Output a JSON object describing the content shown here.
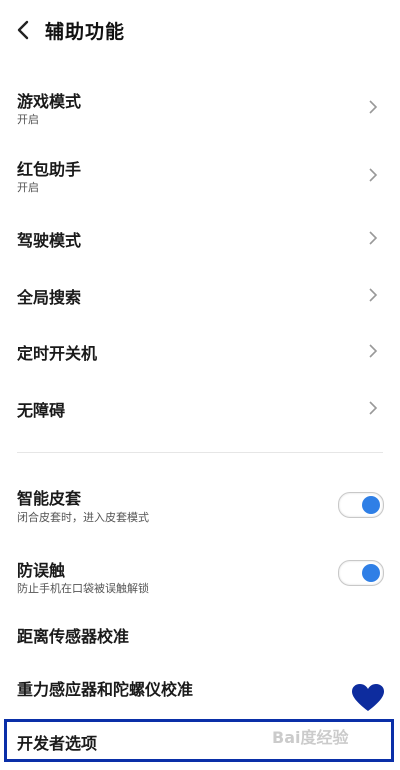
{
  "header": {
    "title": "辅助功能"
  },
  "items": [
    {
      "label": "游戏模式",
      "sub": "开启"
    },
    {
      "label": "红包助手",
      "sub": "开启"
    },
    {
      "label": "驾驶模式"
    },
    {
      "label": "全局搜索"
    },
    {
      "label": "定时开关机"
    },
    {
      "label": "无障碍"
    }
  ],
  "toggles": [
    {
      "label": "智能皮套",
      "sub": "闭合皮套时，进入皮套模式",
      "on": true
    },
    {
      "label": "防误触",
      "sub": "防止手机在口袋被误触解锁",
      "on": true
    }
  ],
  "plain": [
    {
      "label": "距离传感器校准"
    },
    {
      "label": "重力感应器和陀螺仪校准"
    },
    {
      "label": "开发者选项"
    }
  ],
  "watermark": "Bai度经验",
  "colors": {
    "accent": "#2f7fe6",
    "highlight": "#0a2fa8"
  }
}
